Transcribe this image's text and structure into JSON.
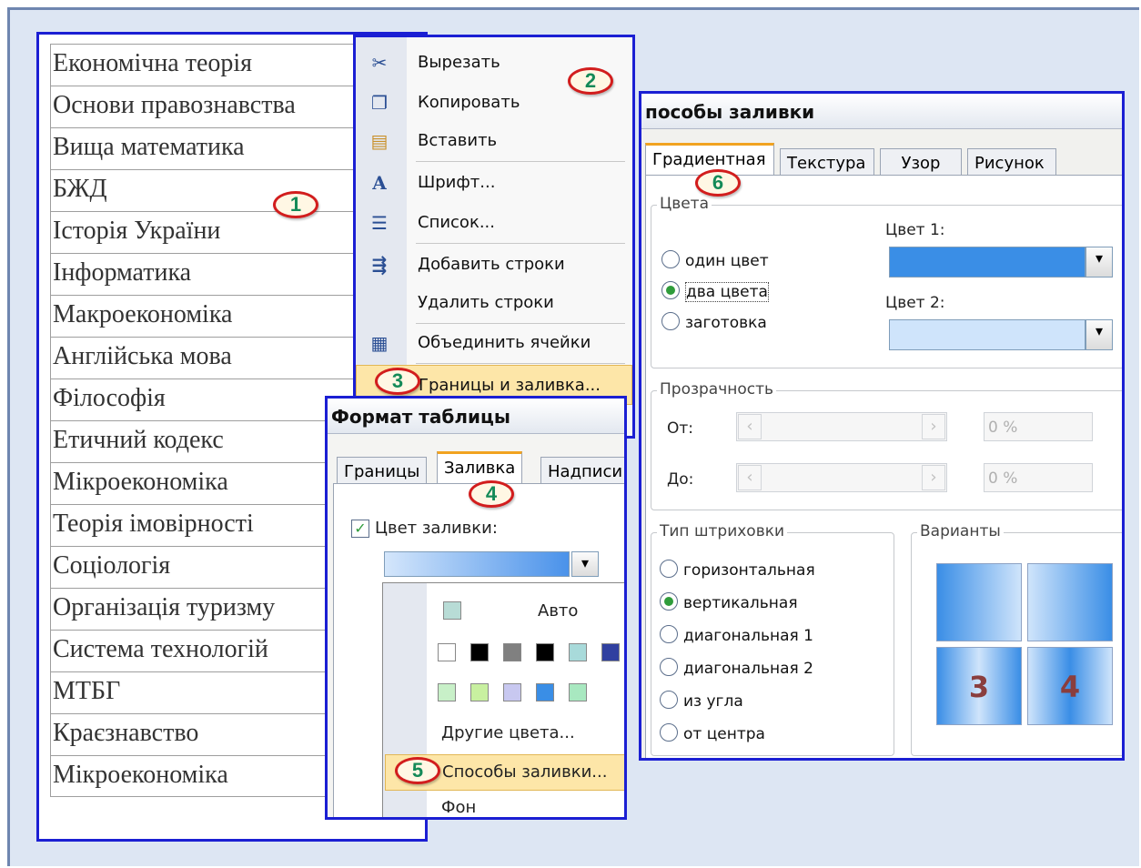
{
  "subjects": [
    "Економічна теорія",
    "Основи правознавства",
    "Вища математика",
    "БЖД",
    "Історія України",
    "Інформатика",
    "Макроекономіка",
    "Англійська мова",
    "Філософія",
    "Етичний кодекс",
    "Мікроекономіка",
    "Теорія імовірності",
    "Соціологія",
    "Організація туризму",
    "Система технологій",
    "МТБГ",
    "Краєзнавство",
    "Мікроекономіка"
  ],
  "markers": {
    "m1": "1",
    "m2": "2",
    "m3": "3",
    "m4": "4",
    "m5": "5",
    "m6": "6"
  },
  "context_menu": {
    "items": [
      {
        "label": "Вырезать",
        "icon": "scissors-icon"
      },
      {
        "label": "Копировать",
        "icon": "copy-icon"
      },
      {
        "label": "Вставить",
        "icon": "paste-icon"
      },
      {
        "label": "Шрифт...",
        "icon": "font-icon"
      },
      {
        "label": "Список...",
        "icon": "list-icon"
      },
      {
        "label": "Добавить строки",
        "icon": "insert-rows-icon"
      },
      {
        "label": "Удалить строки",
        "icon": ""
      },
      {
        "label": "Объединить ячейки",
        "icon": "merge-cells-icon"
      },
      {
        "label": "Границы и заливка...",
        "icon": ""
      }
    ]
  },
  "format_dialog": {
    "title": "Формат таблицы",
    "tabs": [
      "Границы",
      "Заливка",
      "Надписи"
    ],
    "fill_color_label": "Цвет заливки:",
    "auto_label": "Авто",
    "more_colors": "Другие цвета...",
    "fill_methods": "Способы заливки...",
    "background": "Фон",
    "swatch_row1": [
      "#ffffff",
      "#000000",
      "#808080",
      "#000000",
      "#a8dada",
      "#3040a0"
    ],
    "swatch_row2": [
      "#c8f0c8",
      "#c8f0a0",
      "#c8c8f0",
      "#3a8ee6",
      "#a8e8c0"
    ]
  },
  "fill_dialog": {
    "title": "пособы заливки",
    "tabs": [
      "Градиентная",
      "Текстура",
      "Узор",
      "Рисунок"
    ],
    "colors_group": "Цвета",
    "color_options": [
      "один цвет",
      "два цвета",
      "заготовка"
    ],
    "selected_color_option": "два цвета",
    "color1_label": "Цвет 1:",
    "color2_label": "Цвет 2:",
    "color1": "#3a8ee6",
    "color2": "#cfe4fb",
    "transparency_group": "Прозрачность",
    "from_label": "От:",
    "to_label": "До:",
    "from_value": "0 %",
    "to_value": "0 %",
    "shading_group": "Тип штриховки",
    "shading_options": [
      "горизонтальная",
      "вертикальная",
      "диагональная 1",
      "диагональная 2",
      "из угла",
      "от центра"
    ],
    "selected_shading": "вертикальная",
    "variants_group": "Варианты",
    "variant_labels": [
      "",
      "",
      "3",
      "4"
    ]
  }
}
